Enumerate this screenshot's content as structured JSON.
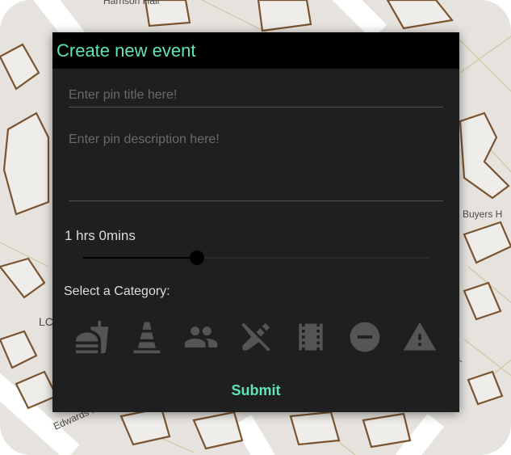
{
  "map": {
    "labels": {
      "top": "Harrison Hall",
      "right": "Buyers H",
      "left": "LC",
      "street": "Edwards Pl",
      "corner": "k"
    }
  },
  "dialog": {
    "title": "Create new event",
    "title_placeholder": "Enter pin title here!",
    "title_value": "",
    "description_placeholder": "Enter pin description here!",
    "description_value": "",
    "duration_label": "1 hrs 0mins",
    "duration_slider_fraction": 0.33,
    "category_label": "Select a Category:",
    "categories": [
      {
        "icon": "fastfood-icon"
      },
      {
        "icon": "traffic-cone-icon"
      },
      {
        "icon": "people-icon"
      },
      {
        "icon": "no-edit-icon"
      },
      {
        "icon": "film-icon"
      },
      {
        "icon": "do-not-enter-icon"
      },
      {
        "icon": "warning-icon"
      }
    ],
    "submit_label": "Submit"
  },
  "colors": {
    "accent": "#5de5b3",
    "dialog_bg": "#1f1f1f",
    "header_bg": "#000000",
    "icon_gray": "#555555"
  }
}
